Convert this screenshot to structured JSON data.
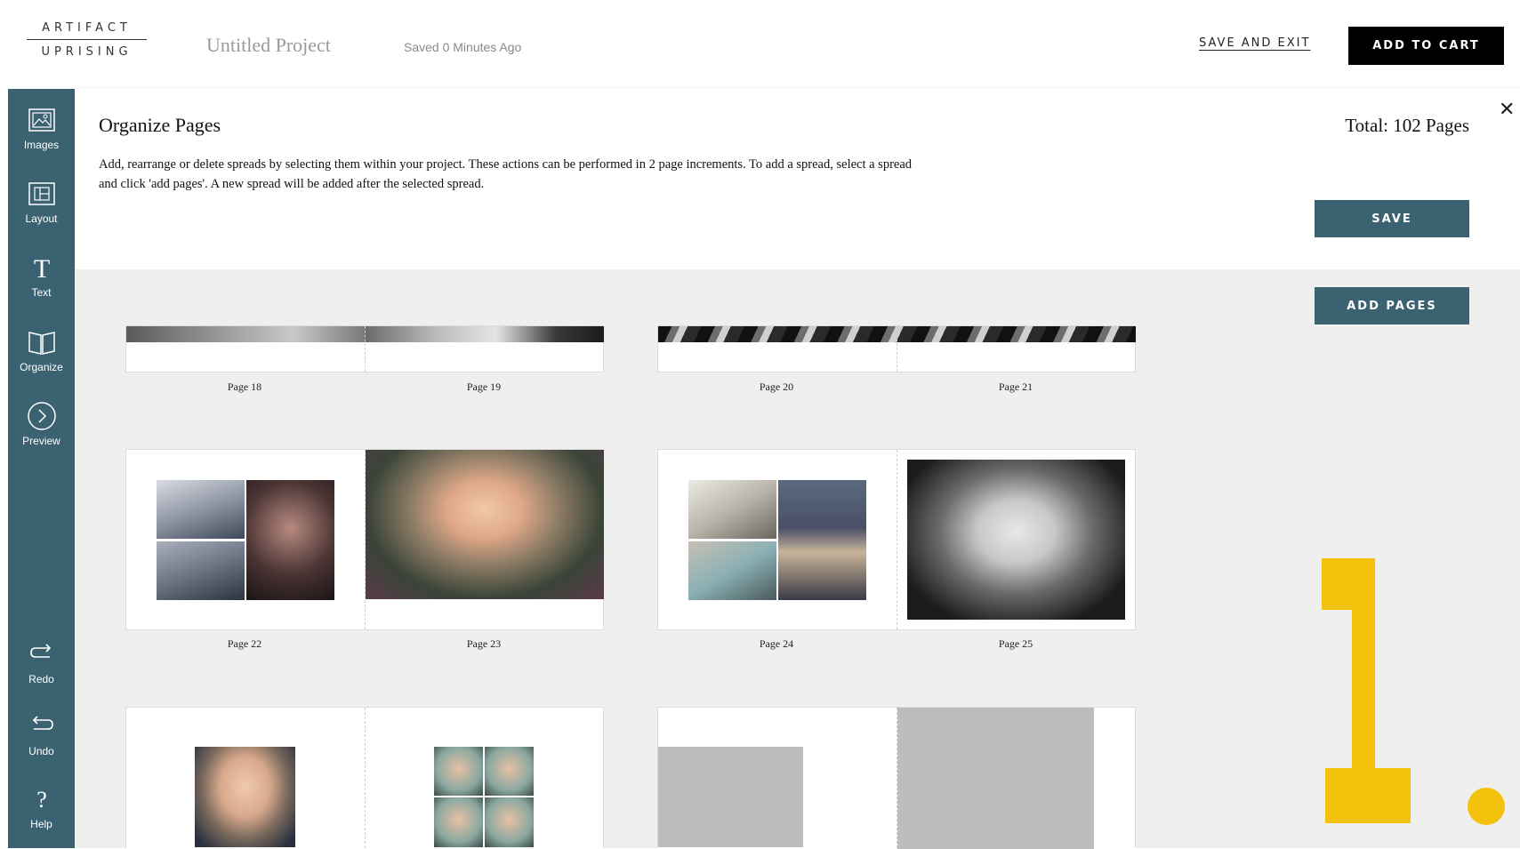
{
  "header": {
    "logo_line1": "ARTIFACT",
    "logo_line2": "UPRISING",
    "project_title": "Untitled Project",
    "saved_status": "Saved 0 Minutes Ago",
    "save_and_exit": "SAVE AND EXIT",
    "add_to_cart": "ADD TO CART"
  },
  "sidebar": {
    "items": [
      {
        "label": "Images",
        "icon": "image-icon"
      },
      {
        "label": "Layout",
        "icon": "layout-icon"
      },
      {
        "label": "Text",
        "icon": "text-icon"
      },
      {
        "label": "Organize",
        "icon": "book-icon"
      },
      {
        "label": "Preview",
        "icon": "chevron-circle-icon"
      }
    ],
    "bottom_items": [
      {
        "label": "Redo",
        "icon": "redo-icon"
      },
      {
        "label": "Undo",
        "icon": "undo-icon"
      },
      {
        "label": "Help",
        "icon": "help-icon"
      }
    ],
    "active_item": "Organize"
  },
  "panel": {
    "title": "Organize Pages",
    "description": "Add, rearrange or delete spreads by selecting them within your project. These actions can be performed in 2 page increments. To add a spread, select a spread and click 'add pages'. A new spread will be added after the selected spread.",
    "total": "Total: 102 Pages",
    "save_button": "SAVE",
    "add_pages_button": "ADD PAGES"
  },
  "pages": {
    "p18": "Page 18",
    "p19": "Page 19",
    "p20": "Page 20",
    "p21": "Page 21",
    "p22": "Page 22",
    "p23": "Page 23",
    "p24": "Page 24",
    "p25": "Page 25"
  },
  "overlay": {
    "step_number": "1",
    "accent_color": "#f4c20d"
  },
  "colors": {
    "sidebar": "#3a6270",
    "button_teal": "#3a6270",
    "workspace": "#efefef"
  }
}
